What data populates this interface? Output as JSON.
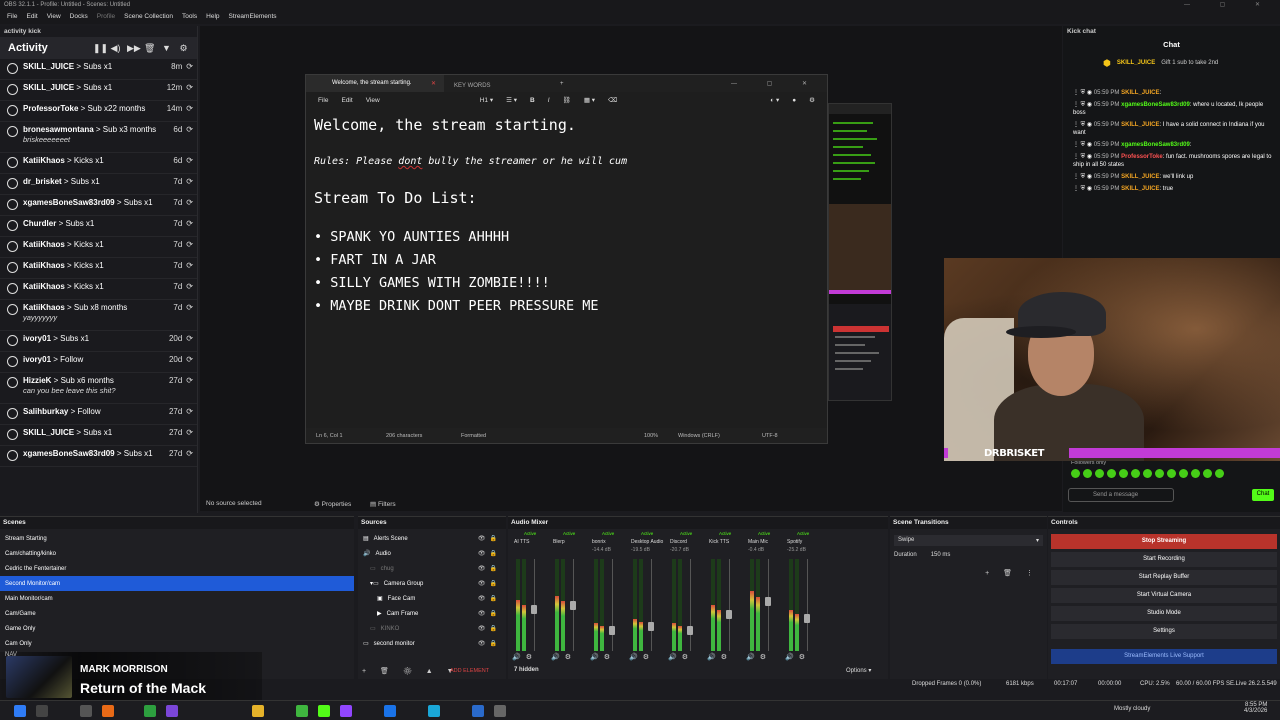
{
  "window": {
    "title": "OBS 32.1.1 - Profile: Untitled - Scenes: Untitled"
  },
  "menu": [
    "File",
    "Edit",
    "View",
    "Docks",
    "Profile",
    "Scene Collection",
    "Tools",
    "Help",
    "StreamElements"
  ],
  "activity": {
    "dock_title": "activity kick",
    "header": "Activity",
    "rows": [
      {
        "who": "SKILL_JUICE",
        "what": " > Subs x1",
        "time": "8m",
        "msg": ""
      },
      {
        "who": "SKILL_JUICE",
        "what": " > Subs x1",
        "time": "12m",
        "msg": ""
      },
      {
        "who": "ProfessorToke",
        "what": " > Sub x22 months",
        "time": "14m",
        "msg": ""
      },
      {
        "who": "bronesawmontana",
        "what": " > Sub x3 months",
        "time": "6d",
        "msg": "briskeeeeeeet"
      },
      {
        "who": "KatiiKhaos",
        "what": " > Kicks x1",
        "time": "6d",
        "msg": ""
      },
      {
        "who": "dr_brisket",
        "what": " > Subs x1",
        "time": "7d",
        "msg": ""
      },
      {
        "who": "xgamesBoneSaw83rd09",
        "what": " > Subs x1",
        "time": "7d",
        "msg": ""
      },
      {
        "who": "Churdler",
        "what": " > Subs x1",
        "time": "7d",
        "msg": ""
      },
      {
        "who": "KatiiKhaos",
        "what": " > Kicks x1",
        "time": "7d",
        "msg": ""
      },
      {
        "who": "KatiiKhaos",
        "what": " > Kicks x1",
        "time": "7d",
        "msg": ""
      },
      {
        "who": "KatiiKhaos",
        "what": " > Kicks x1",
        "time": "7d",
        "msg": ""
      },
      {
        "who": "KatiiKhaos",
        "what": " > Sub x8 months",
        "time": "7d",
        "msg": "yayyyyyyy"
      },
      {
        "who": "ivory01",
        "what": " > Subs x1",
        "time": "20d",
        "msg": ""
      },
      {
        "who": "ivory01",
        "what": " > Follow",
        "time": "20d",
        "msg": ""
      },
      {
        "who": "HizzieK",
        "what": " > Sub x6 months",
        "time": "27d",
        "msg": "can you bee leave this shit?"
      },
      {
        "who": "Salihburkay",
        "what": " > Follow",
        "time": "27d",
        "msg": ""
      },
      {
        "who": "SKILL_JUICE",
        "what": " > Subs x1",
        "time": "27d",
        "msg": ""
      },
      {
        "who": "xgamesBoneSaw83rd09",
        "what": " > Subs x1",
        "time": "27d",
        "msg": ""
      }
    ]
  },
  "notepad": {
    "tab1": "Welcome, the stream starting.",
    "tab2": "KEY WORDS",
    "menu_file": "File",
    "menu_edit": "Edit",
    "menu_view": "View",
    "heading": "Welcome, the stream starting.",
    "rules_pre": "Rules: Please ",
    "rules_dont": "dont",
    "rules_post": " bully the streamer or he will cum",
    "todo_title": "Stream To Do List:",
    "todo": [
      "SPANK YO AUNTIES AHHHH",
      "FART IN A JAR",
      "SILLY GAMES WITH ZOMBIE!!!!",
      "MAYBE DRINK DONT PEER PRESSURE ME"
    ],
    "status": {
      "pos": "Ln 6, Col 1",
      "chars": "206 characters",
      "format": "Formatted",
      "zoom": "100%",
      "eol": "Windows (CRLF)",
      "enc": "UTF-8"
    }
  },
  "kick": {
    "dock_title": "Kick chat",
    "header": "Chat",
    "pinned_user": "SKILL_JUICE",
    "pinned_text": "Gift 1 sub to take 2nd",
    "lines": [
      {
        "time": "05:59 PM",
        "name": "SKILL_JUICE",
        "cls": "or",
        "text": ":"
      },
      {
        "time": "05:59 PM",
        "name": "xgamesBoneSaw83rd09",
        "cls": "",
        "text": ": where u located, Ik people boss"
      },
      {
        "time": "05:59 PM",
        "name": "SKILL_JUICE",
        "cls": "or",
        "text": ": I have a solid connect in Indiana if you want"
      },
      {
        "time": "05:59 PM",
        "name": "xgamesBoneSaw83rd09",
        "cls": "",
        "text": ":"
      },
      {
        "time": "05:59 PM",
        "name": "ProfessorToke",
        "cls": "rd",
        "text": ": fun fact. mushrooms spores are legal to ship in all 50 states"
      },
      {
        "time": "05:59 PM",
        "name": "SKILL_JUICE",
        "cls": "or",
        "text": ": we'll link up"
      },
      {
        "time": "05:59 PM",
        "name": "SKILL_JUICE",
        "cls": "or",
        "text": ": true"
      }
    ],
    "followers_only": "Followers only",
    "send_placeholder": "Send a message",
    "chat_button": "Chat"
  },
  "cam": {
    "name": "DRBRISKET"
  },
  "sourcebar": {
    "no_source": "No source selected",
    "properties": "Properties",
    "filters": "Filters"
  },
  "scenes": {
    "title": "Scenes",
    "items": [
      "Stream Starting",
      "Cam/chatting/kinko",
      "Cedric the Fentertainer",
      "Second Monitor/cam",
      "Main Monitor/cam",
      "Cam/Game",
      "Game Only",
      "Cam Only",
      "NAV"
    ],
    "selected": 3
  },
  "sources": {
    "title": "Sources",
    "items": [
      "Alerts Scene",
      "Audio",
      "chug",
      "Camera Group",
      "Face Cam",
      "Cam Frame",
      "KINKO",
      "second monitor"
    ],
    "add": "ADD ELEMENT"
  },
  "mixer": {
    "title": "Audio Mixer",
    "hidden": "7 hidden",
    "options": "Options",
    "channels": [
      {
        "name": "AI TTS",
        "db": "",
        "level": 0.55
      },
      {
        "name": "Blerp",
        "db": "",
        "level": 0.6
      },
      {
        "name": "bonrix",
        "db": "-14.4 dB",
        "level": 0.3
      },
      {
        "name": "Desktop Audio",
        "db": "-19.5 dB",
        "level": 0.35
      },
      {
        "name": "Discord",
        "db": "-20.7 dB",
        "level": 0.3
      },
      {
        "name": "Kick TTS",
        "db": "",
        "level": 0.5
      },
      {
        "name": "Main Mic",
        "db": "-0.4 dB",
        "level": 0.65
      },
      {
        "name": "Spotify",
        "db": "-25.2 dB",
        "level": 0.45
      }
    ]
  },
  "transitions": {
    "title": "Scene Transitions",
    "type": "Swipe",
    "duration_label": "Duration",
    "duration": "150 ms"
  },
  "controls": {
    "title": "Controls",
    "buttons": [
      "Stop Streaming",
      "Start Recording",
      "Start Replay Buffer",
      "Start Virtual Camera",
      "Studio Mode",
      "Settings"
    ],
    "se": "StreamElements Live Support"
  },
  "status": {
    "dropped": "Dropped Frames 0 (0.0%)",
    "kbps": "6181 kbps",
    "time": "00:17:07",
    "rec": "00:00:00",
    "cpu": "CPU: 2.5%",
    "fps": "60.00 / 60.00 FPS",
    "se": "SE.Live 26.2.5.549"
  },
  "music": {
    "artist": "MARK MORRISON",
    "title": "Return of the Mack"
  },
  "taskbar": {
    "weather": "Mostly cloudy",
    "clock": "8:55 PM",
    "date": "4/3/2026"
  }
}
